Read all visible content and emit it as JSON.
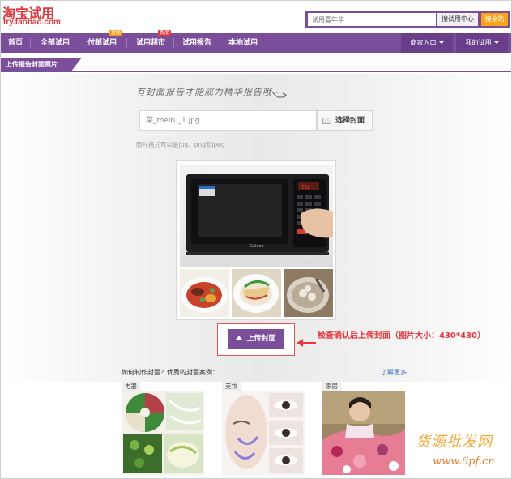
{
  "header": {
    "logo_text": "淘宝试用",
    "logo_url": "try.taobao.com",
    "search_placeholder": "试用嘉年华",
    "search_try_label": "搜试用中心",
    "search_all_label": "搜全站"
  },
  "nav": {
    "items": [
      {
        "label": "首页"
      },
      {
        "label": "全部试用"
      },
      {
        "label": "付邮试用",
        "badge": "付邮"
      },
      {
        "label": "试用超市",
        "badge": "新品"
      },
      {
        "label": "试用报告"
      },
      {
        "label": "本地试用"
      }
    ],
    "merchant_label": "商家入口",
    "my_trial_label": "我的试用"
  },
  "section": {
    "title": "上传报告封面照片"
  },
  "upload": {
    "hint": "有封面报告才能成为精华报告哦~",
    "file_value": "菜_meitu_1.jpg",
    "choose_label": "选择封面",
    "format_note": "照片格式可以是jpg、png和jpeg",
    "upload_label": "上传封面",
    "annotation": "检查确认后上传封面（图片大小：430*430）"
  },
  "examples": {
    "title": "如何制作封面？优秀的封面案例：",
    "more_label": "了解更多",
    "categories": [
      "电器",
      "美妆",
      "家居"
    ]
  },
  "watermark": {
    "text": "货源批发网",
    "url": "www.6pf.cn"
  },
  "colors": {
    "brand_purple": "#7b4e9c",
    "logo_red": "#e4393c",
    "accent_orange": "#f6a51d"
  }
}
